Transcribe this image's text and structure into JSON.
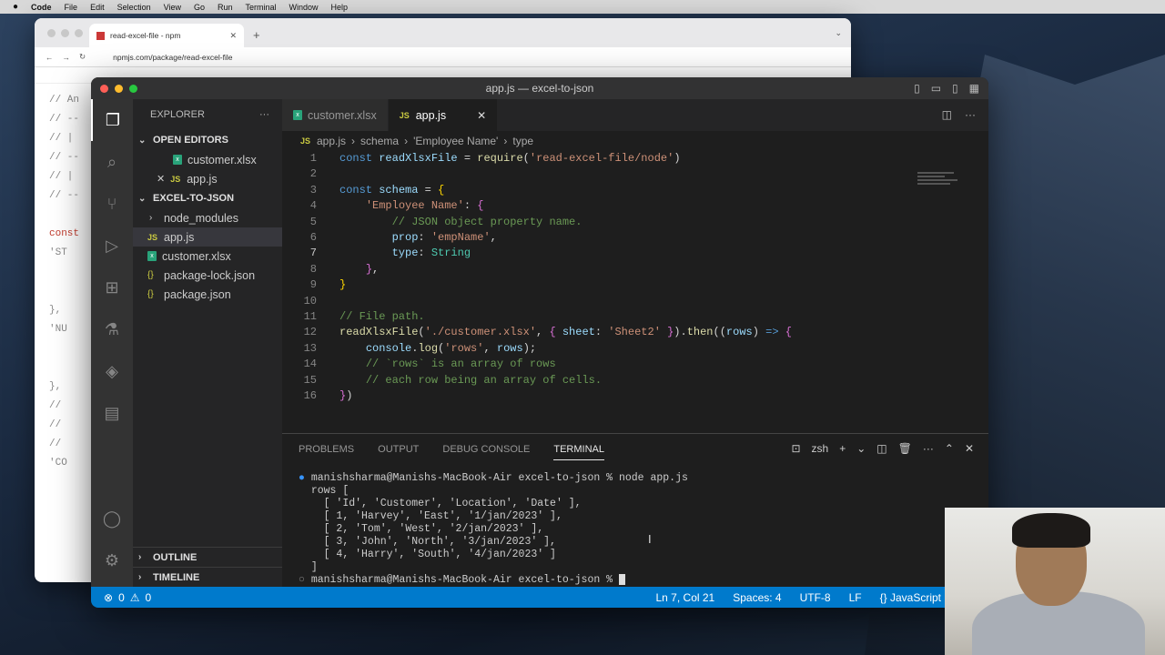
{
  "menubar": {
    "apple": "",
    "items": [
      "Code",
      "File",
      "Edit",
      "Selection",
      "View",
      "Go",
      "Run",
      "Terminal",
      "Window",
      "Help"
    ]
  },
  "browser": {
    "tab_title": "read-excel-file - npm",
    "url": "npmjs.com/package/read-excel-file",
    "code_lines": [
      "// An",
      "// --",
      "// |",
      "// --",
      "// |",
      "// --",
      "",
      "const",
      "  'ST",
      "",
      "",
      "  },",
      "  'NU",
      "",
      "",
      "  },",
      "  //",
      "  //",
      "  //",
      "  'CO",
      "",
      "",
      ""
    ]
  },
  "vscode": {
    "title": "app.js — excel-to-json",
    "explorer_label": "EXPLORER",
    "open_editors_label": "OPEN EDITORS",
    "open_editors": [
      {
        "name": "customer.xlsx",
        "type": "xlsx"
      },
      {
        "name": "app.js",
        "type": "js"
      }
    ],
    "project_label": "EXCEL-TO-JSON",
    "files": [
      {
        "name": "node_modules",
        "type": "folder"
      },
      {
        "name": "app.js",
        "type": "js"
      },
      {
        "name": "customer.xlsx",
        "type": "xlsx"
      },
      {
        "name": "package-lock.json",
        "type": "json"
      },
      {
        "name": "package.json",
        "type": "json"
      }
    ],
    "outline_label": "OUTLINE",
    "timeline_label": "TIMELINE",
    "tabs": [
      {
        "name": "customer.xlsx",
        "active": false
      },
      {
        "name": "app.js",
        "active": true
      }
    ],
    "breadcrumbs": [
      "app.js",
      "schema",
      "'Employee Name'",
      "type"
    ],
    "code": {
      "line_numbers": [
        "1",
        "2",
        "3",
        "4",
        "5",
        "6",
        "7",
        "8",
        "9",
        "10",
        "11",
        "12",
        "13",
        "14",
        "15",
        "16"
      ],
      "current_line": 7
    },
    "panel_tabs": [
      "PROBLEMS",
      "OUTPUT",
      "DEBUG CONSOLE",
      "TERMINAL"
    ],
    "active_panel_tab": "TERMINAL",
    "shell": "zsh",
    "terminal": {
      "prompt": "manishsharma@Manishs-MacBook-Air excel-to-json % ",
      "command": "node app.js",
      "output_head": "rows [",
      "rows": [
        "  [ 'Id', 'Customer', 'Location', 'Date' ],",
        "  [ 1, 'Harvey', 'East', '1/jan/2023' ],",
        "  [ 2, 'Tom', 'West', '2/jan/2023' ],",
        "  [ 3, 'John', 'North', '3/jan/2023' ],",
        "  [ 4, 'Harry', 'South', '4/jan/2023' ]"
      ],
      "output_tail": "]"
    },
    "status": {
      "errors": "0",
      "warnings": "0",
      "position": "Ln 7, Col 21",
      "spaces": "Spaces: 4",
      "encoding": "UTF-8",
      "eol": "LF",
      "language": "JavaScript"
    }
  }
}
